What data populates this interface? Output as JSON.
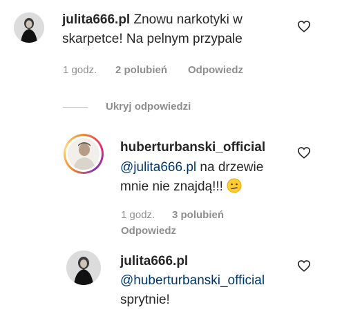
{
  "comments": [
    {
      "username": "julita666.pl",
      "text_line1": "Znowu narkotyki w",
      "text_line2": "skarpetce! Na pelnym przypale",
      "time": "1 godz.",
      "likes": "2 polubień",
      "reply": "Odpowiedz"
    }
  ],
  "hide_replies": "Ukryj odpowiedzi",
  "replies": [
    {
      "username": "huberturbanski_official",
      "mention": "@julita666.pl",
      "text_after_mention": " na drzewie",
      "text_line2": "mnie nie znajdą!!!",
      "emoji": "confused-face-emoji",
      "time": "1 godz.",
      "likes": "3 polubień",
      "reply": "Odpowiedz"
    },
    {
      "username": "julita666.pl",
      "mention": "@huberturbanski_official",
      "text_line2": "sprytnie!"
    }
  ],
  "icons": {
    "like": "heart-outline-icon"
  },
  "colors": {
    "text": "#262626",
    "meta": "#8e8e8e",
    "mention": "#00376b"
  }
}
